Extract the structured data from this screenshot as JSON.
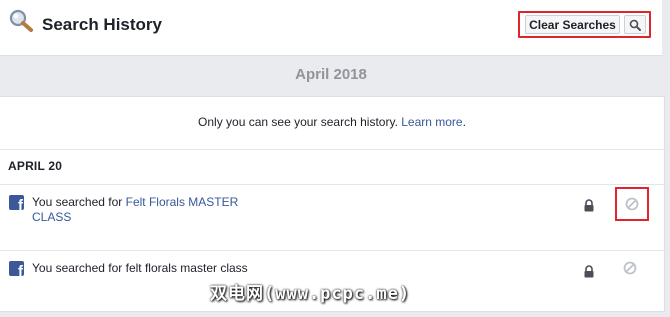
{
  "header": {
    "title": "Search History",
    "clear_label": "Clear Searches",
    "icons": {
      "header": "magnifier-icon",
      "search": "search-icon"
    }
  },
  "month_label": "April 2018",
  "privacy": {
    "text": "Only you can see your search history. ",
    "link": "Learn more",
    "suffix": "."
  },
  "date_group": "APRIL 20",
  "items": [
    {
      "prefix": "You searched for ",
      "query": "Felt Florals MASTER CLASS",
      "query_is_link": true,
      "icons": [
        "facebook-icon",
        "lock-icon",
        "hide-icon"
      ]
    },
    {
      "prefix": "You searched for ",
      "query": "felt florals master class",
      "query_is_link": false,
      "icons": [
        "facebook-icon",
        "lock-icon",
        "hide-icon"
      ]
    }
  ],
  "watermark": "双电网(www.pcpc.me)",
  "colors": {
    "accent_link": "#365899",
    "highlight": "#e0242b",
    "facebook": "#3b5998",
    "background": "#e9ebee"
  }
}
